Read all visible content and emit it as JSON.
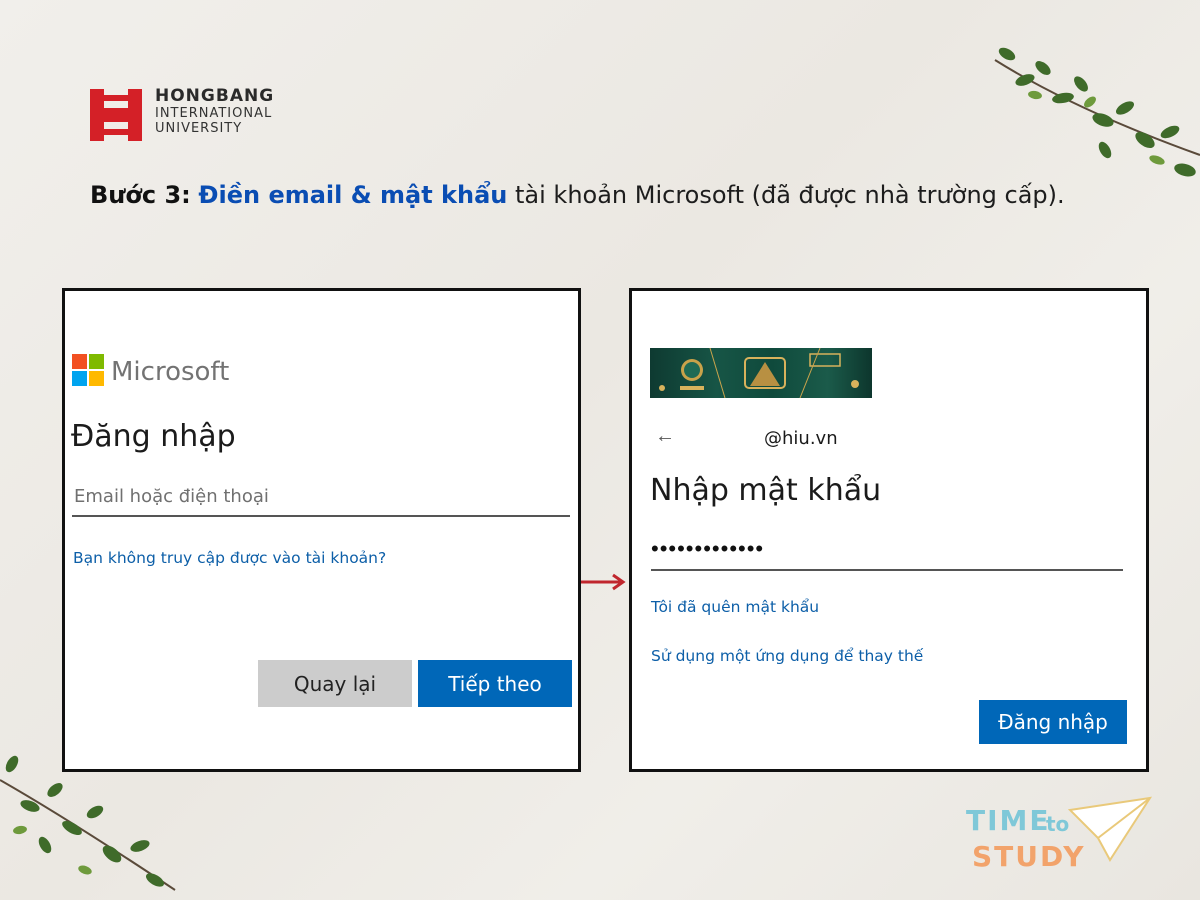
{
  "brand": {
    "line1": "HONGBANG",
    "line2": "INTERNATIONAL",
    "line3": "UNIVERSITY",
    "color": "#d42027"
  },
  "step": {
    "label": "Bước 3:",
    "highlight": "Điền email & mật khẩu",
    "rest": " tài khoản Microsoft (đã được nhà trường cấp)."
  },
  "signin_panel": {
    "ms_wordmark": "Microsoft",
    "title": "Đăng nhập",
    "email_placeholder": "Email hoặc điện thoại",
    "cant_access_link": "Bạn không truy cập được vào tài khoản?",
    "back_button": "Quay lại",
    "next_button": "Tiếp theo"
  },
  "password_panel": {
    "back_icon": "left-arrow-icon",
    "email": "@hiu.vn",
    "title": "Nhập mật khẩu",
    "password_masked": "•••••••••••••",
    "forgot_link": "Tôi đã quên mật khẩu",
    "alt_app_link": "Sử dụng một ứng dụng để thay thế",
    "signin_button": "Đăng nhập"
  },
  "badge": {
    "time": "TIME",
    "to": "to",
    "study": "STUDY"
  },
  "colors": {
    "accent_blue": "#0067b8",
    "heading_blue": "#0a4db3",
    "arrow_red": "#c0262d"
  }
}
